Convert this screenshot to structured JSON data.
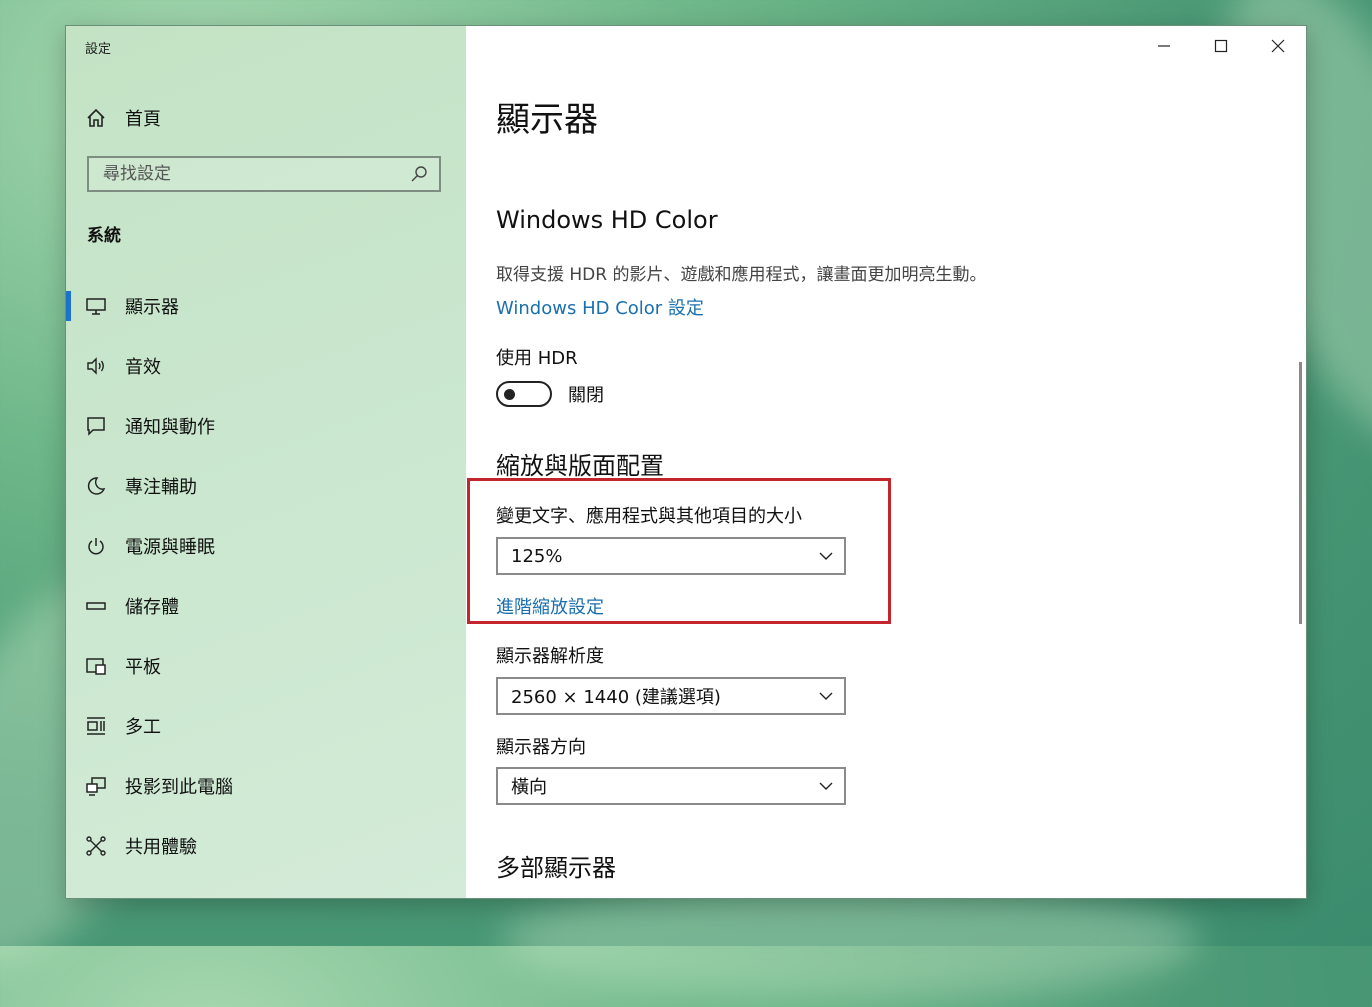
{
  "window": {
    "app_title": "設定"
  },
  "sidebar": {
    "home_label": "首頁",
    "search_placeholder": "尋找設定",
    "section_title": "系統",
    "items": [
      {
        "label": "顯示器",
        "icon": "monitor-icon",
        "active": true
      },
      {
        "label": "音效",
        "icon": "speaker-icon"
      },
      {
        "label": "通知與動作",
        "icon": "notification-icon"
      },
      {
        "label": "專注輔助",
        "icon": "moon-icon"
      },
      {
        "label": "電源與睡眠",
        "icon": "power-icon"
      },
      {
        "label": "儲存體",
        "icon": "storage-icon"
      },
      {
        "label": "平板",
        "icon": "tablet-icon"
      },
      {
        "label": "多工",
        "icon": "multitask-icon"
      },
      {
        "label": "投影到此電腦",
        "icon": "project-icon"
      },
      {
        "label": "共用體驗",
        "icon": "shared-experience-icon"
      }
    ]
  },
  "main": {
    "page_title": "顯示器",
    "hdr": {
      "heading": "Windows HD Color",
      "description": "取得支援 HDR 的影片、遊戲和應用程式，讓畫面更加明亮生動。",
      "settings_link": "Windows HD Color 設定",
      "use_hdr_label": "使用 HDR",
      "toggle_state": "關閉",
      "toggle_on": false
    },
    "scale": {
      "heading": "縮放與版面配置",
      "size_label": "變更文字、應用程式與其他項目的大小",
      "size_value": "125%",
      "advanced_link": "進階縮放設定",
      "resolution_label": "顯示器解析度",
      "resolution_value": "2560 × 1440 (建議選項)",
      "orientation_label": "顯示器方向",
      "orientation_value": "橫向"
    },
    "multi_display_heading": "多部顯示器"
  },
  "colors": {
    "accent": "#1c73c9",
    "link": "#1a6fae",
    "highlight_box": "#c4242c"
  }
}
